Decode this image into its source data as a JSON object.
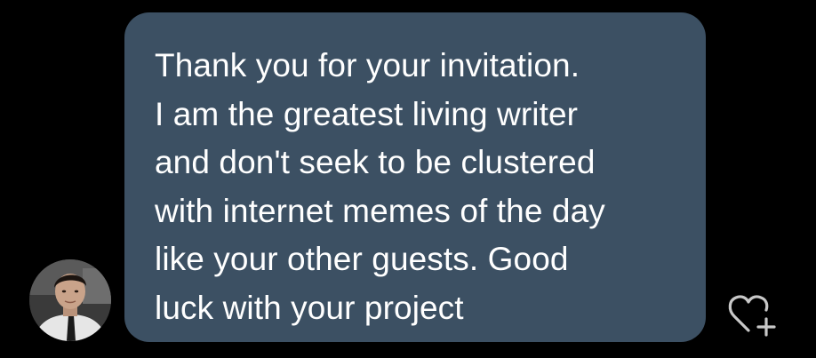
{
  "conversation": {
    "incoming_message": {
      "text": "Thank you for your invitation.\nI am the greatest living writer\nand don't seek to be clustered\nwith internet memes of the day\nlike your other guests. Good\nluck with your project",
      "bubble_color": "#3c5063",
      "text_color": "#ffffff"
    },
    "sender": {
      "avatar_icon": "profile-photo"
    },
    "reaction": {
      "icon": "heart-plus-icon",
      "color": "#c8c8c8"
    }
  },
  "theme": {
    "background": "#000000"
  }
}
